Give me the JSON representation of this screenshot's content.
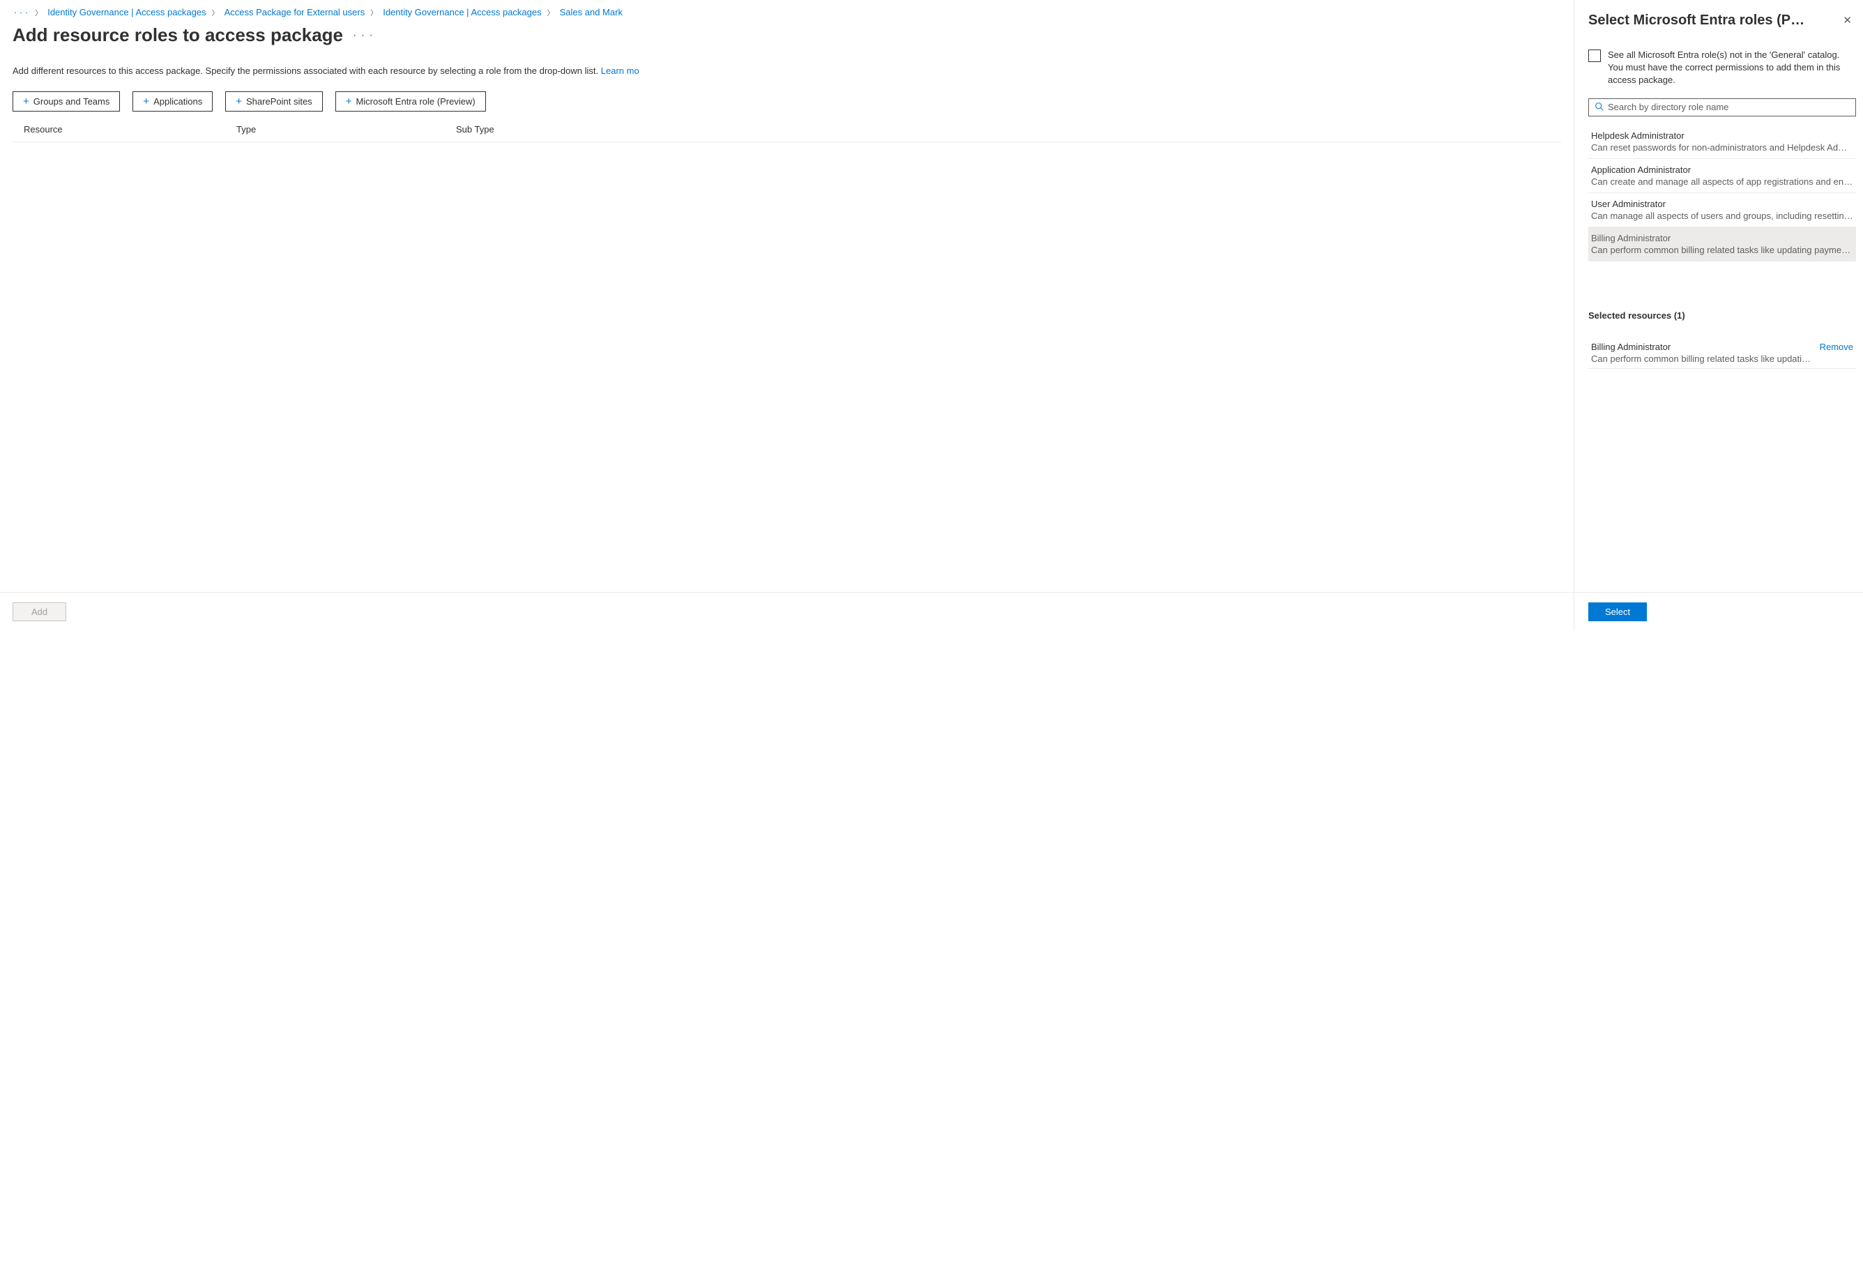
{
  "breadcrumb": {
    "ellipsis": "· · ·",
    "items": [
      "Identity Governance | Access packages",
      "Access Package for External users",
      "Identity Governance | Access packages",
      "Sales and Mark"
    ]
  },
  "page": {
    "title": "Add resource roles to access package",
    "more_icon": "· · ·",
    "description": "Add different resources to this access package. Specify the permissions associated with each resource by selecting a role from the drop-down list. ",
    "learn_more": "Learn mo"
  },
  "resource_buttons": {
    "groups": "Groups and Teams",
    "applications": "Applications",
    "sharepoint": "SharePoint sites",
    "entra_role": "Microsoft Entra role (Preview)"
  },
  "columns": {
    "resource": "Resource",
    "type": "Type",
    "subtype": "Sub Type"
  },
  "footer": {
    "add": "Add"
  },
  "panel": {
    "title": "Select Microsoft Entra roles (P…",
    "see_all_text": "See all Microsoft Entra role(s) not in the 'General' catalog. You must have the correct permissions to add them in this access package.",
    "search_placeholder": "Search by directory role name",
    "roles": [
      {
        "name": "Helpdesk Administrator",
        "desc": "Can reset passwords for non-administrators and Helpdesk Admin…"
      },
      {
        "name": "Application Administrator",
        "desc": "Can create and manage all aspects of app registrations and enter…"
      },
      {
        "name": "User Administrator",
        "desc": "Can manage all aspects of users and groups, including resetting …"
      },
      {
        "name": "Billing Administrator",
        "desc": "Can perform common billing related tasks like updating payment…"
      }
    ],
    "selected_heading": "Selected resources (1)",
    "selected": [
      {
        "name": "Billing Administrator",
        "desc": "Can perform common billing related tasks like updatin…"
      }
    ],
    "remove": "Remove",
    "select": "Select"
  }
}
